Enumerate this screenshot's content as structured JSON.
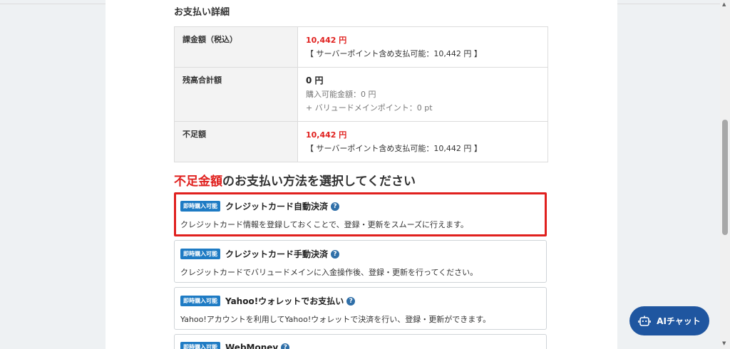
{
  "payment_details": {
    "title": "お支払い詳細",
    "rows": [
      {
        "label": "課金額（税込）",
        "amount": "10,442 円",
        "note": "【 サーバーポイント含め支払可能：10,442 円 】"
      },
      {
        "label": "残高合計額",
        "amount": "0 円",
        "sub1": "購入可能金額：0 円",
        "sub2": "+ バリュードメインポイント：0 pt"
      },
      {
        "label": "不足額",
        "amount": "10,442 円",
        "note": "【 サーバーポイント含め支払可能：10,442 円 】"
      }
    ]
  },
  "method_section": {
    "title_highlight": "不足金額",
    "title_rest": "のお支払い方法を選択してください"
  },
  "options": [
    {
      "badge": "即時購入可能",
      "title": "クレジットカード自動決済",
      "desc": "クレジットカード情報を登録しておくことで、登録・更新をスムーズに行えます。",
      "selected": true
    },
    {
      "badge": "即時購入可能",
      "title": "クレジットカード手動決済",
      "desc": "クレジットカードでバリュードメインに入金操作後、登録・更新を行ってください。"
    },
    {
      "badge": "即時購入可能",
      "title": "Yahoo!ウォレットでお支払い",
      "desc": "Yahoo!アカウントを利用してYahoo!ウォレットで決済を行い、登録・更新ができます。"
    },
    {
      "badge": "即時購入可能",
      "title": "WebMoney",
      "desc": ""
    }
  ],
  "help_glyph": "?",
  "ai_chat": {
    "label": "AIチャット",
    "icon": "robot-icon"
  },
  "colors": {
    "accent_red": "#e0201e",
    "badge_blue": "#1e7bc4",
    "ai_button": "#1f56a0"
  }
}
